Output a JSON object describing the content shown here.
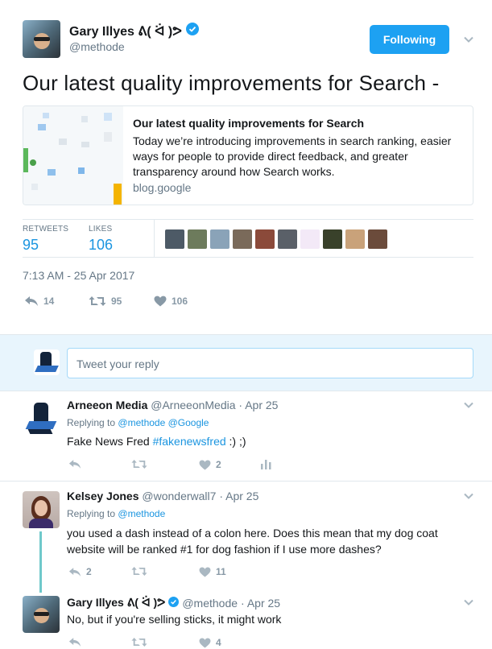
{
  "tweet": {
    "author_name": "Gary Illyes ᕕ( ᐛ )ᕗ",
    "handle": "@methode",
    "follow_label": "Following",
    "text": "Our latest quality improvements for Search -",
    "card": {
      "title": "Our latest quality improvements for Search",
      "description": "Today we’re introducing improvements in search ranking, easier ways for people to provide direct feedback, and greater transparency around how Search works.",
      "domain": "blog.google"
    },
    "stats": {
      "retweets_label": "RETWEETS",
      "retweets": "95",
      "likes_label": "LIKES",
      "likes": "106"
    },
    "timestamp": "7:13 AM - 25 Apr 2017",
    "actions": {
      "replies": "14",
      "retweets": "95",
      "likes": "106"
    }
  },
  "reply_box": {
    "placeholder": "Tweet your reply"
  },
  "replies": [
    {
      "name": "Arneeon Media",
      "handle": "@ArneeonMedia",
      "time": "· Apr 25",
      "replying_label": "Replying to",
      "replying_to": "@methode @Google",
      "text_prefix": "Fake News Fred ",
      "hashtag": "#fakenewsfred",
      "text_suffix": " :) ;)",
      "likes": "2"
    },
    {
      "name": "Kelsey Jones",
      "handle": "@wonderwall7",
      "time": "· Apr 25",
      "replying_label": "Replying to",
      "replying_to": "@methode",
      "text": "you used a dash instead of a colon here. Does this mean that my dog coat website will be ranked #1 for dog fashion if I use more dashes?",
      "replies": "2",
      "likes": "11"
    },
    {
      "name": "Gary Illyes ᕕ( ᐛ )ᕗ",
      "handle": "@methode",
      "time": "· Apr 25",
      "text": "No, but if you're selling sticks, it might work",
      "likes": "4"
    }
  ],
  "colors": {
    "accent": "#1da1f2",
    "thread_line": "#6fc9cb",
    "reply_bg": "#e8f5fd"
  }
}
